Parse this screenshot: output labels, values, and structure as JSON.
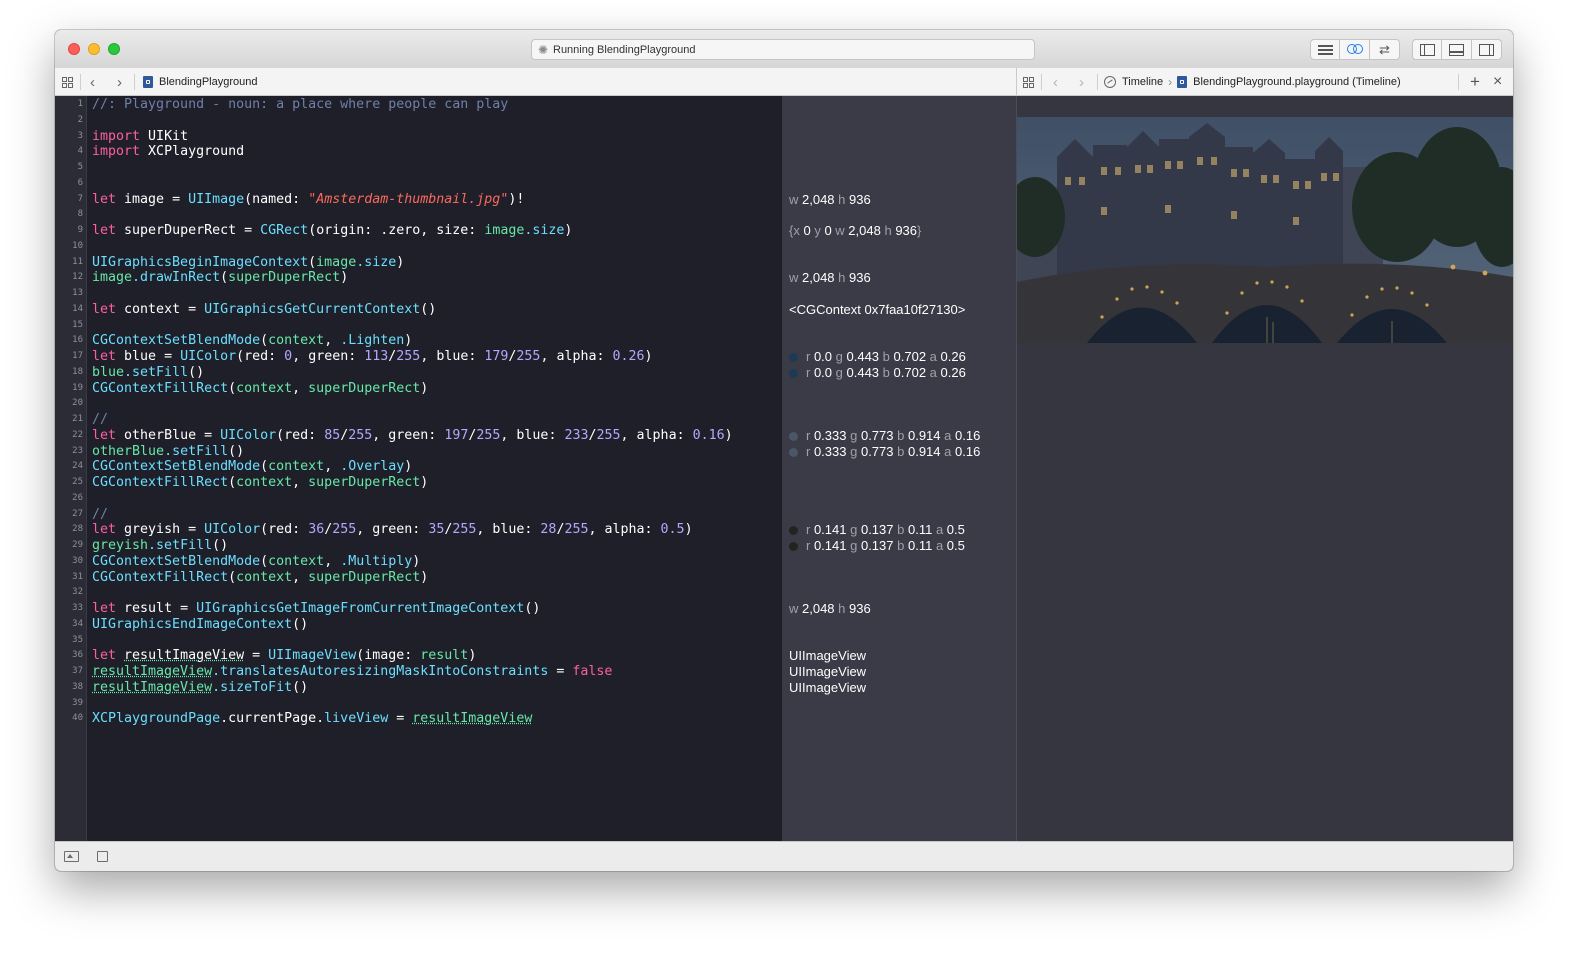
{
  "window": {
    "activity_status": "Running BlendingPlayground",
    "spinner_glyph": "✺"
  },
  "icons": {
    "back": "‹",
    "forward": "›",
    "plus": "+",
    "close": "×",
    "crumb_chevron": "›"
  },
  "editor_jumpbar": {
    "file_name": "BlendingPlayground"
  },
  "assistant_jumpbar": {
    "crumb_1": "Timeline",
    "crumb_2": "BlendingPlayground.playground (Timeline)"
  },
  "line_numbers": [
    "1",
    "2",
    "3",
    "4",
    "5",
    "6",
    "7",
    "8",
    "9",
    "10",
    "11",
    "12",
    "13",
    "14",
    "15",
    "16",
    "17",
    "18",
    "19",
    "20",
    "21",
    "22",
    "23",
    "24",
    "25",
    "26",
    "27",
    "28",
    "29",
    "30",
    "31",
    "32",
    "33",
    "34",
    "35",
    "36",
    "37",
    "38",
    "39",
    "40"
  ],
  "code": [
    [
      [
        "c",
        "//: Playground - noun: a place where people can play"
      ]
    ],
    [],
    [
      [
        "k",
        "import"
      ],
      [
        "p",
        " UIKit"
      ]
    ],
    [
      [
        "k",
        "import"
      ],
      [
        "p",
        " XCPlayground"
      ]
    ],
    [],
    [],
    [
      [
        "k",
        "let"
      ],
      [
        "p",
        " image = "
      ],
      [
        "t",
        "UIImage"
      ],
      [
        "p",
        "(named: "
      ],
      [
        "s",
        "\"Amsterdam-thumbnail.jpg\""
      ],
      [
        "p",
        ")!"
      ]
    ],
    [],
    [
      [
        "k",
        "let"
      ],
      [
        "p",
        " superDuperRect = "
      ],
      [
        "t",
        "CGRect"
      ],
      [
        "p",
        "(origin: .zero, size: "
      ],
      [
        "v",
        "image"
      ],
      [
        "t",
        ".size"
      ],
      [
        "p",
        ")"
      ]
    ],
    [],
    [
      [
        "t",
        "UIGraphicsBeginImageContext"
      ],
      [
        "p",
        "("
      ],
      [
        "v",
        "image"
      ],
      [
        "t",
        ".size"
      ],
      [
        "p",
        ")"
      ]
    ],
    [
      [
        "v",
        "image"
      ],
      [
        "t",
        ".drawInRect"
      ],
      [
        "p",
        "("
      ],
      [
        "v",
        "superDuperRect"
      ],
      [
        "p",
        ")"
      ]
    ],
    [],
    [
      [
        "k",
        "let"
      ],
      [
        "p",
        " context = "
      ],
      [
        "t",
        "UIGraphicsGetCurrentContext"
      ],
      [
        "p",
        "()"
      ]
    ],
    [],
    [
      [
        "t",
        "CGContextSetBlendMode"
      ],
      [
        "p",
        "("
      ],
      [
        "v",
        "context"
      ],
      [
        "p",
        ", "
      ],
      [
        "t",
        ".Lighten"
      ],
      [
        "p",
        ")"
      ]
    ],
    [
      [
        "k",
        "let"
      ],
      [
        "p",
        " blue = "
      ],
      [
        "t",
        "UIColor"
      ],
      [
        "p",
        "(red: "
      ],
      [
        "n",
        "0"
      ],
      [
        "p",
        ", green: "
      ],
      [
        "n",
        "113"
      ],
      [
        "p",
        "/"
      ],
      [
        "n",
        "255"
      ],
      [
        "p",
        ", blue: "
      ],
      [
        "n",
        "179"
      ],
      [
        "p",
        "/"
      ],
      [
        "n",
        "255"
      ],
      [
        "p",
        ", alpha: "
      ],
      [
        "n",
        "0.26"
      ],
      [
        "p",
        ")"
      ]
    ],
    [
      [
        "v",
        "blue"
      ],
      [
        "t",
        ".setFill"
      ],
      [
        "p",
        "()"
      ]
    ],
    [
      [
        "t",
        "CGContextFillRect"
      ],
      [
        "p",
        "("
      ],
      [
        "v",
        "context"
      ],
      [
        "p",
        ", "
      ],
      [
        "v",
        "superDuperRect"
      ],
      [
        "p",
        ")"
      ]
    ],
    [],
    [
      [
        "c",
        "//"
      ]
    ],
    [
      [
        "k",
        "let"
      ],
      [
        "p",
        " otherBlue = "
      ],
      [
        "t",
        "UIColor"
      ],
      [
        "p",
        "(red: "
      ],
      [
        "n",
        "85"
      ],
      [
        "p",
        "/"
      ],
      [
        "n",
        "255"
      ],
      [
        "p",
        ", green: "
      ],
      [
        "n",
        "197"
      ],
      [
        "p",
        "/"
      ],
      [
        "n",
        "255"
      ],
      [
        "p",
        ", blue: "
      ],
      [
        "n",
        "233"
      ],
      [
        "p",
        "/"
      ],
      [
        "n",
        "255"
      ],
      [
        "p",
        ", alpha: "
      ],
      [
        "n",
        "0.16"
      ],
      [
        "p",
        ")"
      ]
    ],
    [
      [
        "v",
        "otherBlue"
      ],
      [
        "t",
        ".setFill"
      ],
      [
        "p",
        "()"
      ]
    ],
    [
      [
        "t",
        "CGContextSetBlendMode"
      ],
      [
        "p",
        "("
      ],
      [
        "v",
        "context"
      ],
      [
        "p",
        ", "
      ],
      [
        "t",
        ".Overlay"
      ],
      [
        "p",
        ")"
      ]
    ],
    [
      [
        "t",
        "CGContextFillRect"
      ],
      [
        "p",
        "("
      ],
      [
        "v",
        "context"
      ],
      [
        "p",
        ", "
      ],
      [
        "v",
        "superDuperRect"
      ],
      [
        "p",
        ")"
      ]
    ],
    [],
    [
      [
        "c",
        "//"
      ]
    ],
    [
      [
        "k",
        "let"
      ],
      [
        "p",
        " greyish = "
      ],
      [
        "t",
        "UIColor"
      ],
      [
        "p",
        "(red: "
      ],
      [
        "n",
        "36"
      ],
      [
        "p",
        "/"
      ],
      [
        "n",
        "255"
      ],
      [
        "p",
        ", green: "
      ],
      [
        "n",
        "35"
      ],
      [
        "p",
        "/"
      ],
      [
        "n",
        "255"
      ],
      [
        "p",
        ", blue: "
      ],
      [
        "n",
        "28"
      ],
      [
        "p",
        "/"
      ],
      [
        "n",
        "255"
      ],
      [
        "p",
        ", alpha: "
      ],
      [
        "n",
        "0.5"
      ],
      [
        "p",
        ")"
      ]
    ],
    [
      [
        "v",
        "greyish"
      ],
      [
        "t",
        ".setFill"
      ],
      [
        "p",
        "()"
      ]
    ],
    [
      [
        "t",
        "CGContextSetBlendMode"
      ],
      [
        "p",
        "("
      ],
      [
        "v",
        "context"
      ],
      [
        "p",
        ", "
      ],
      [
        "t",
        ".Multiply"
      ],
      [
        "p",
        ")"
      ]
    ],
    [
      [
        "t",
        "CGContextFillRect"
      ],
      [
        "p",
        "("
      ],
      [
        "v",
        "context"
      ],
      [
        "p",
        ", "
      ],
      [
        "v",
        "superDuperRect"
      ],
      [
        "p",
        ")"
      ]
    ],
    [],
    [
      [
        "k",
        "let"
      ],
      [
        "p",
        " result = "
      ],
      [
        "t",
        "UIGraphicsGetImageFromCurrentImageContext"
      ],
      [
        "p",
        "()"
      ]
    ],
    [
      [
        "t",
        "UIGraphicsEndImageContext"
      ],
      [
        "p",
        "()"
      ]
    ],
    [],
    [
      [
        "k",
        "let"
      ],
      [
        "p",
        " "
      ],
      [
        "d",
        "resultImageView"
      ],
      [
        "p",
        " = "
      ],
      [
        "t",
        "UIImageView"
      ],
      [
        "p",
        "(image: "
      ],
      [
        "v",
        "result"
      ],
      [
        "p",
        ")"
      ]
    ],
    [
      [
        "vd",
        "resultImageView"
      ],
      [
        "t",
        ".translatesAutoresizingMaskIntoConstraints"
      ],
      [
        "p",
        " = "
      ],
      [
        "k",
        "false"
      ]
    ],
    [
      [
        "vd",
        "resultImageView"
      ],
      [
        "t",
        ".sizeToFit"
      ],
      [
        "p",
        "()"
      ]
    ],
    [],
    [
      [
        "t",
        "XCPlaygroundPage"
      ],
      [
        "p",
        ".currentPage."
      ],
      [
        "t",
        "liveView"
      ],
      [
        "p",
        " = "
      ],
      [
        "vd",
        "resultImageView"
      ]
    ]
  ],
  "results": [
    {
      "line": 7,
      "parts": [
        [
          "l",
          "w "
        ],
        [
          "v",
          "2,048"
        ],
        [
          "l",
          " h "
        ],
        [
          "v",
          "936"
        ]
      ]
    },
    {
      "line": 9,
      "parts": [
        [
          "l",
          "{x "
        ],
        [
          "v",
          "0"
        ],
        [
          "l",
          " y "
        ],
        [
          "v",
          "0"
        ],
        [
          "l",
          " w "
        ],
        [
          "v",
          "2,048"
        ],
        [
          "l",
          " h "
        ],
        [
          "v",
          "936"
        ],
        [
          "l",
          "}"
        ]
      ]
    },
    {
      "line": 12,
      "parts": [
        [
          "l",
          "w "
        ],
        [
          "v",
          "2,048"
        ],
        [
          "l",
          " h "
        ],
        [
          "v",
          "936"
        ]
      ]
    },
    {
      "line": 14,
      "parts": [
        [
          "v",
          "<CGContext 0x7faa10f27130>"
        ]
      ]
    },
    {
      "line": 17,
      "swatch": "#1d3a55",
      "parts": [
        [
          "l",
          "r "
        ],
        [
          "v",
          "0.0"
        ],
        [
          "l",
          " g "
        ],
        [
          "v",
          "0.443"
        ],
        [
          "l",
          " b "
        ],
        [
          "v",
          "0.702"
        ],
        [
          "l",
          " a "
        ],
        [
          "v",
          "0.26"
        ]
      ]
    },
    {
      "line": 18,
      "swatch": "#1d3a55",
      "parts": [
        [
          "l",
          "r "
        ],
        [
          "v",
          "0.0"
        ],
        [
          "l",
          " g "
        ],
        [
          "v",
          "0.443"
        ],
        [
          "l",
          " b "
        ],
        [
          "v",
          "0.702"
        ],
        [
          "l",
          " a "
        ],
        [
          "v",
          "0.26"
        ]
      ]
    },
    {
      "line": 22,
      "swatch": "#4a5766",
      "parts": [
        [
          "l",
          "r "
        ],
        [
          "v",
          "0.333"
        ],
        [
          "l",
          " g "
        ],
        [
          "v",
          "0.773"
        ],
        [
          "l",
          " b "
        ],
        [
          "v",
          "0.914"
        ],
        [
          "l",
          " a "
        ],
        [
          "v",
          "0.16"
        ]
      ]
    },
    {
      "line": 23,
      "swatch": "#4a5766",
      "parts": [
        [
          "l",
          "r "
        ],
        [
          "v",
          "0.333"
        ],
        [
          "l",
          " g "
        ],
        [
          "v",
          "0.773"
        ],
        [
          "l",
          " b "
        ],
        [
          "v",
          "0.914"
        ],
        [
          "l",
          " a "
        ],
        [
          "v",
          "0.16"
        ]
      ]
    },
    {
      "line": 28,
      "swatch": "#24231f",
      "parts": [
        [
          "l",
          "r "
        ],
        [
          "v",
          "0.141"
        ],
        [
          "l",
          " g "
        ],
        [
          "v",
          "0.137"
        ],
        [
          "l",
          " b "
        ],
        [
          "v",
          "0.11"
        ],
        [
          "l",
          " a "
        ],
        [
          "v",
          "0.5"
        ]
      ]
    },
    {
      "line": 29,
      "swatch": "#24231f",
      "parts": [
        [
          "l",
          "r "
        ],
        [
          "v",
          "0.141"
        ],
        [
          "l",
          " g "
        ],
        [
          "v",
          "0.137"
        ],
        [
          "l",
          " b "
        ],
        [
          "v",
          "0.11"
        ],
        [
          "l",
          " a "
        ],
        [
          "v",
          "0.5"
        ]
      ]
    },
    {
      "line": 33,
      "parts": [
        [
          "l",
          "w "
        ],
        [
          "v",
          "2,048"
        ],
        [
          "l",
          " h "
        ],
        [
          "v",
          "936"
        ]
      ]
    },
    {
      "line": 36,
      "parts": [
        [
          "v",
          "UIImageView"
        ]
      ]
    },
    {
      "line": 37,
      "parts": [
        [
          "v",
          "UIImageView"
        ]
      ]
    },
    {
      "line": 38,
      "parts": [
        [
          "v",
          "UIImageView"
        ]
      ]
    }
  ],
  "colors": {
    "editor_bg": "#1f1f29",
    "results_bg": "#3a3b46",
    "keyword": "#fc5fa3",
    "type": "#6bdfff",
    "string": "#fc6a5d",
    "number": "#b7a6ff",
    "variable": "#67e8a8",
    "comment": "#7080a8"
  }
}
